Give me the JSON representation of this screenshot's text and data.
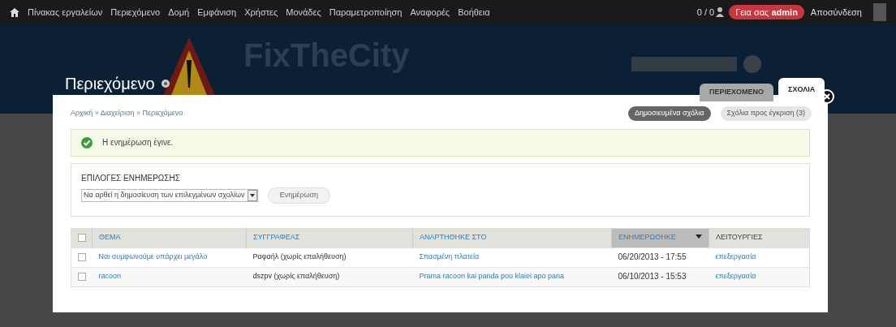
{
  "toolbar": {
    "menu": [
      "Πίνακας εργαλείων",
      "Περιεχόμενο",
      "Δομή",
      "Εμφάνιση",
      "Χρήστες",
      "Μονάδες",
      "Παραμετροποίηση",
      "Αναφορές",
      "Βοήθεια"
    ],
    "counter": "0 / 0",
    "greeting": "Γεια σας **admin**",
    "logout": "Αποσύνδεση"
  },
  "site": {
    "name": "FixTheCity"
  },
  "overlay": {
    "title": "Περιεχόμενο",
    "tabs": [
      {
        "label": "ΠΕΡΙΕΧΟΜΕΝΟ",
        "selected": false
      },
      {
        "label": "ΣΧΟΛΙΑ",
        "selected": true
      }
    ],
    "breadcrumb": "Αρχική » Διαχείριση » Περιεχόμενο",
    "subtabs": [
      {
        "label": "Δημοσιευμένα σχόλια",
        "selected": true
      },
      {
        "label": "Σχόλια προς έγκριση (3)",
        "selected": false
      }
    ],
    "message": "Η ενημέρωση έγινε.",
    "update_options": {
      "legend": "ΕΠΙΛΟΓΕΣ ΕΝΗΜΕΡΩΣΗΣ",
      "select": "Να αρθεί η δημοσίευση των επιλεγμένων σχολίων",
      "button": "Ενημέρωση"
    },
    "table": {
      "select_all_checked": false,
      "columns": [
        {
          "label": "ΘΕΜΑ",
          "sorted": false
        },
        {
          "label": "ΣΥΓΓΡΑΦΕΑΣ",
          "sorted": false
        },
        {
          "label": "ΑΝΑΡΤΗΘΗΚΕ ΣΤΟ",
          "sorted": false
        },
        {
          "label": "ΕΝΗΜΕΡΩΘΗΚΕ",
          "sorted": true
        },
        {
          "label": "ΛΕΙΤΟΥΡΓΙΕΣ",
          "sorted": false
        }
      ],
      "rows": [
        {
          "checked": false,
          "subject": "Ναι συμφωνούμε υπάρχει μεγάλο",
          "author": "Ραφαήλ (χωρίς επαλήθευση)",
          "posted_in": "Σπασμένη πλατεία",
          "updated": "06/20/2013 - 17:55",
          "operation": "επεξεργασία"
        },
        {
          "checked": false,
          "subject": "racoon",
          "author": "dszpv (χωρίς επαλήθευση)",
          "posted_in": "Prama racoon kai panda pou klaiei apo pana",
          "updated": "06/10/2013 - 15:53",
          "operation": "επεξεργασία"
        }
      ]
    }
  }
}
